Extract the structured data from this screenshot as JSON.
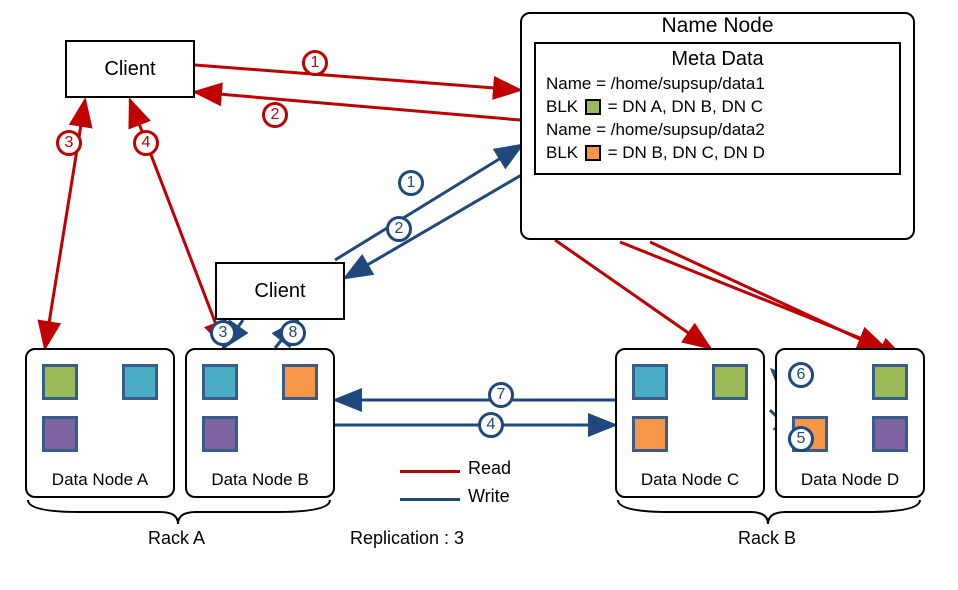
{
  "namenode": {
    "title": "Name Node",
    "meta_title": "Meta Data",
    "line1_label": "Name = ",
    "line1_value": "/home/supsup/data1",
    "line2_label": "BLK",
    "line2_value": "= DN A, DN B, DN C",
    "line3_label": "Name = ",
    "line3_value": "/home/supsup/data2",
    "line4_label": "BLK",
    "line4_value": "= DN B, DN C, DN D"
  },
  "clients": {
    "c1": "Client",
    "c2": "Client"
  },
  "datanodes": {
    "a": "Data Node A",
    "b": "Data Node B",
    "c": "Data Node C",
    "d": "Data Node D"
  },
  "racks": {
    "a": "Rack A",
    "b": "Rack B"
  },
  "legend": {
    "read": "Read",
    "write": "Write"
  },
  "replication_label": "Replication : 3",
  "steps": {
    "read": {
      "s1": "1",
      "s2": "2",
      "s3": "3",
      "s4": "4"
    },
    "write": {
      "s1": "1",
      "s2": "2",
      "s3": "3",
      "s4": "4",
      "s5": "5",
      "s6": "6",
      "s7": "7",
      "s8": "8"
    }
  }
}
